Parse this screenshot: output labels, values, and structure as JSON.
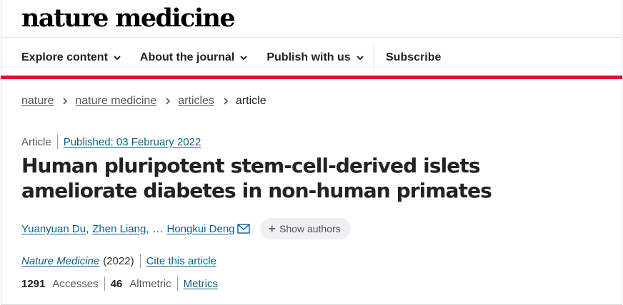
{
  "header": {
    "logo_text": "nature medicine"
  },
  "nav": {
    "items": [
      {
        "label": "Explore content"
      },
      {
        "label": "About the journal"
      },
      {
        "label": "Publish with us"
      }
    ],
    "subscribe_label": "Subscribe"
  },
  "breadcrumb": {
    "items": [
      "nature",
      "nature medicine",
      "articles"
    ],
    "current": "article"
  },
  "article": {
    "type": "Article",
    "published": "Published: 03 February 2022",
    "title": "Human pluripotent stem-cell-derived islets ameliorate diabetes in non-human primates",
    "authors": {
      "first": "Yuanyuan Du",
      "second": "Zhen Liang",
      "separator": ",",
      "ellipsis": "…",
      "last": "Hongkui Deng",
      "show_authors_label": "Show authors"
    },
    "journal": "Nature Medicine",
    "year": "(2022)",
    "cite_label": "Cite this article",
    "metrics": {
      "accesses_count": "1291",
      "accesses_label": "Accesses",
      "altmetric_count": "46",
      "altmetric_label": "Altmetric",
      "metrics_link": "Metrics"
    }
  },
  "colors": {
    "accent_red": "#e00d32",
    "link_blue": "#0a5f8c"
  }
}
